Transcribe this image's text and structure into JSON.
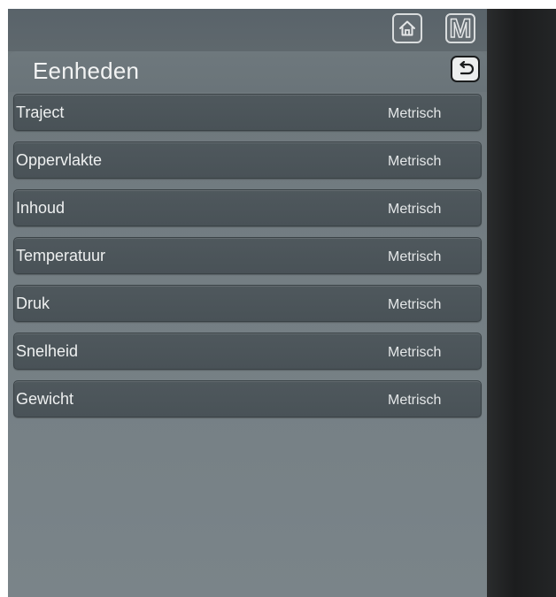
{
  "topbar": {
    "home_icon": "home-icon",
    "mode_icon_label": "M"
  },
  "header": {
    "title": "Eenheden",
    "back_icon": "back-arrow-icon"
  },
  "units": [
    {
      "label": "Traject",
      "value": "Metrisch"
    },
    {
      "label": "Oppervlakte",
      "value": "Metrisch"
    },
    {
      "label": "Inhoud",
      "value": "Metrisch"
    },
    {
      "label": "Temperatuur",
      "value": "Metrisch"
    },
    {
      "label": "Druk",
      "value": "Metrisch"
    },
    {
      "label": "Snelheid",
      "value": "Metrisch"
    },
    {
      "label": "Gewicht",
      "value": "Metrisch"
    }
  ],
  "colors": {
    "screen_bg": "#737d82",
    "row_bg": "#4c555a",
    "text": "#eef0f0"
  }
}
